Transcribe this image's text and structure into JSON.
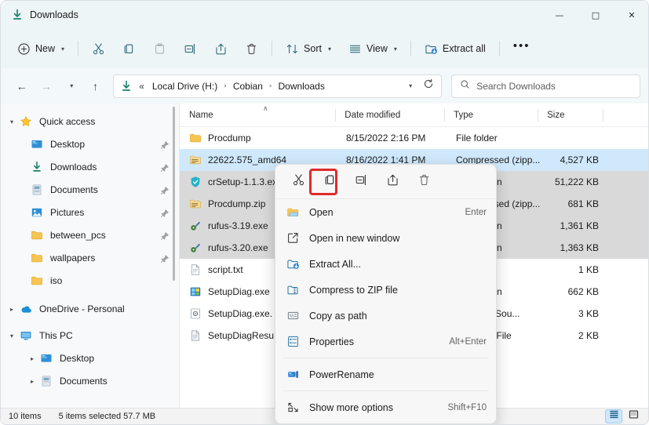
{
  "window": {
    "title": "Downloads",
    "title_icon": "download-icon",
    "controls": [
      {
        "name": "minimize",
        "glyph": "—"
      },
      {
        "name": "maximize",
        "glyph": "□"
      },
      {
        "name": "close",
        "glyph": "✕"
      }
    ]
  },
  "toolbar": {
    "new_label": "New",
    "sort_label": "Sort",
    "view_label": "View",
    "extract_all_label": "Extract all",
    "more_label": "•••",
    "items": [
      {
        "icon": "cut-icon",
        "name": "cut-button",
        "disabled": false
      },
      {
        "icon": "copy-icon",
        "name": "copy-button",
        "disabled": false
      },
      {
        "icon": "paste-icon",
        "name": "paste-button",
        "disabled": true
      },
      {
        "icon": "rename-icon",
        "name": "rename-button",
        "disabled": false
      },
      {
        "icon": "share-icon",
        "name": "share-button",
        "disabled": false
      },
      {
        "icon": "delete-icon",
        "name": "delete-button",
        "disabled": false
      }
    ]
  },
  "address": {
    "back": "←",
    "forward": "→",
    "recent": "⌄",
    "up": "↑",
    "overflow": "«",
    "crumbs": [
      "Local Drive (H:)",
      "Cobian",
      "Downloads"
    ],
    "separator": "›",
    "dropdown": "⌄",
    "refresh": "refresh-icon"
  },
  "search": {
    "placeholder": "Search Downloads",
    "icon": "search-icon"
  },
  "sidebar": {
    "items": [
      {
        "label": "Quick access",
        "icon": "star-icon",
        "expander": "⌄",
        "level": 0,
        "pinned": false
      },
      {
        "label": "Desktop",
        "icon": "desktop-icon",
        "expander": "",
        "level": 1,
        "pinned": true
      },
      {
        "label": "Downloads",
        "icon": "download-icon",
        "expander": "",
        "level": 1,
        "pinned": true
      },
      {
        "label": "Documents",
        "icon": "documents-icon",
        "expander": "",
        "level": 1,
        "pinned": true
      },
      {
        "label": "Pictures",
        "icon": "pictures-icon",
        "expander": "",
        "level": 1,
        "pinned": true
      },
      {
        "label": "between_pcs",
        "icon": "folder-icon",
        "expander": "",
        "level": 1,
        "pinned": true
      },
      {
        "label": "wallpapers",
        "icon": "folder-icon",
        "expander": "",
        "level": 1,
        "pinned": true
      },
      {
        "label": "iso",
        "icon": "folder-icon",
        "expander": "",
        "level": 1,
        "pinned": false
      },
      {
        "label": "OneDrive - Personal",
        "icon": "onedrive-icon",
        "expander": "›",
        "level": 0,
        "pinned": false
      },
      {
        "label": "This PC",
        "icon": "pc-icon",
        "expander": "⌄",
        "level": 0,
        "pinned": false
      },
      {
        "label": "Desktop",
        "icon": "desktop-icon",
        "expander": "›",
        "level": 1,
        "pinned": false
      },
      {
        "label": "Documents",
        "icon": "documents-icon",
        "expander": "›",
        "level": 1,
        "pinned": false
      }
    ]
  },
  "filelist": {
    "columns": [
      "Name",
      "Date modified",
      "Type",
      "Size"
    ],
    "sort_indicator": "∧",
    "rows": [
      {
        "name": "Procdump",
        "date": "8/15/2022 2:16 PM",
        "type": "File folder",
        "size": "",
        "icon": "folder-icon",
        "state": "none"
      },
      {
        "name": "22622.575_amd64",
        "date": "8/16/2022 1:41 PM",
        "type": "Compressed (zipp...",
        "size": "4,527 KB",
        "icon": "zip-icon",
        "state": "selected"
      },
      {
        "name": "crSetup-1.1.3.exe",
        "date": "",
        "type": "Application",
        "size": "51,222 KB",
        "icon": "shield-icon",
        "state": "multi"
      },
      {
        "name": "Procdump.zip",
        "date": "",
        "type": "Compressed (zipp...",
        "size": "681 KB",
        "icon": "zip-icon",
        "state": "multi"
      },
      {
        "name": "rufus-3.19.exe",
        "date": "",
        "type": "Application",
        "size": "1,361 KB",
        "icon": "rufus-icon",
        "state": "multi"
      },
      {
        "name": "rufus-3.20.exe",
        "date": "",
        "type": "Application",
        "size": "1,363 KB",
        "icon": "rufus-icon",
        "state": "multi"
      },
      {
        "name": "script.txt",
        "date": "",
        "type": "",
        "size": "1 KB",
        "icon": "text-icon",
        "state": "none"
      },
      {
        "name": "SetupDiag.exe",
        "date": "",
        "type": "Application",
        "size": "662 KB",
        "icon": "app-icon",
        "state": "none"
      },
      {
        "name": "SetupDiag.exe.",
        "date": "",
        "type": "...uration Sou...",
        "size": "3 KB",
        "icon": "config-icon",
        "state": "none"
      },
      {
        "name": "SetupDiagResu",
        "date": "",
        "type": "...Source File",
        "size": "2 KB",
        "icon": "text-icon",
        "state": "none"
      }
    ]
  },
  "context_menu": {
    "toolbar": [
      {
        "label": "Cut",
        "icon": "cut-icon",
        "name": "ctx-cut-button",
        "highlighted": false
      },
      {
        "label": "Copy",
        "icon": "copy-icon",
        "name": "ctx-copy-button",
        "highlighted": true
      },
      {
        "label": "Rename",
        "icon": "rename-icon",
        "name": "ctx-rename-button",
        "highlighted": false
      },
      {
        "label": "Share",
        "icon": "share-icon",
        "name": "ctx-share-button",
        "highlighted": false
      },
      {
        "label": "Delete",
        "icon": "delete-icon",
        "name": "ctx-delete-button",
        "highlighted": false
      }
    ],
    "items": [
      {
        "label": "Open",
        "accel": "Enter",
        "icon": "folder-open-icon"
      },
      {
        "label": "Open in new window",
        "accel": "",
        "icon": "open-new-window-icon"
      },
      {
        "label": "Extract All...",
        "accel": "",
        "icon": "extract-all-icon"
      },
      {
        "label": "Compress to ZIP file",
        "accel": "",
        "icon": "compress-zip-icon"
      },
      {
        "label": "Copy as path",
        "accel": "",
        "icon": "copy-path-icon"
      },
      {
        "label": "Properties",
        "accel": "Alt+Enter",
        "icon": "properties-icon"
      },
      {
        "label": "PowerRename",
        "accel": "",
        "icon": "powerrename-icon"
      }
    ],
    "more_options": {
      "label": "Show more options",
      "accel": "Shift+F10",
      "icon": "show-more-icon"
    }
  },
  "statusbar": {
    "item_count": "10 items",
    "selection": "5 items selected  57.7 MB",
    "views": [
      {
        "name": "details-view-toggle",
        "icon": "details-icon",
        "active": true
      },
      {
        "name": "large-icons-view-toggle",
        "icon": "large-icons-icon",
        "active": false
      }
    ]
  },
  "colors": {
    "titlebar": "#eef5f7",
    "accent_selection": "#cfe8fb",
    "multi_selection": "#d9d9d9",
    "highlight_box": "#e02b2b",
    "folder_yellow": "#f6c552"
  }
}
